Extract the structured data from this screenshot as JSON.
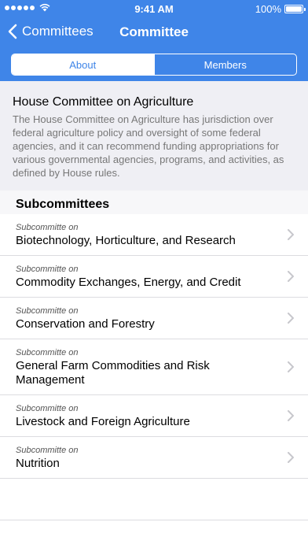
{
  "status_bar": {
    "time": "9:41 AM",
    "battery": "100%"
  },
  "nav": {
    "back_label": "Committees",
    "title": "Committee"
  },
  "tabs": [
    {
      "label": "About",
      "active": true
    },
    {
      "label": "Members",
      "active": false
    }
  ],
  "committee": {
    "name": "House Committee on Agriculture",
    "description": "The House Committee on Agriculture has jurisdiction over federal agriculture policy and oversight of some federal agencies, and it can recommend funding appropriations for various governmental agencies, programs, and activities, as defined by House rules."
  },
  "subcommittees": {
    "header": "Subcommittees",
    "prefix": "Subcommitte on",
    "items": [
      {
        "name": "Biotechnology, Horticulture, and Research"
      },
      {
        "name": "Commodity Exchanges, Energy, and Credit"
      },
      {
        "name": "Conservation and Forestry"
      },
      {
        "name": "General Farm Commodities and Risk Management"
      },
      {
        "name": "Livestock and Foreign Agriculture"
      },
      {
        "name": "Nutrition"
      }
    ]
  },
  "colors": {
    "accent": "#3f85e8",
    "background_gray": "#efeff4"
  }
}
